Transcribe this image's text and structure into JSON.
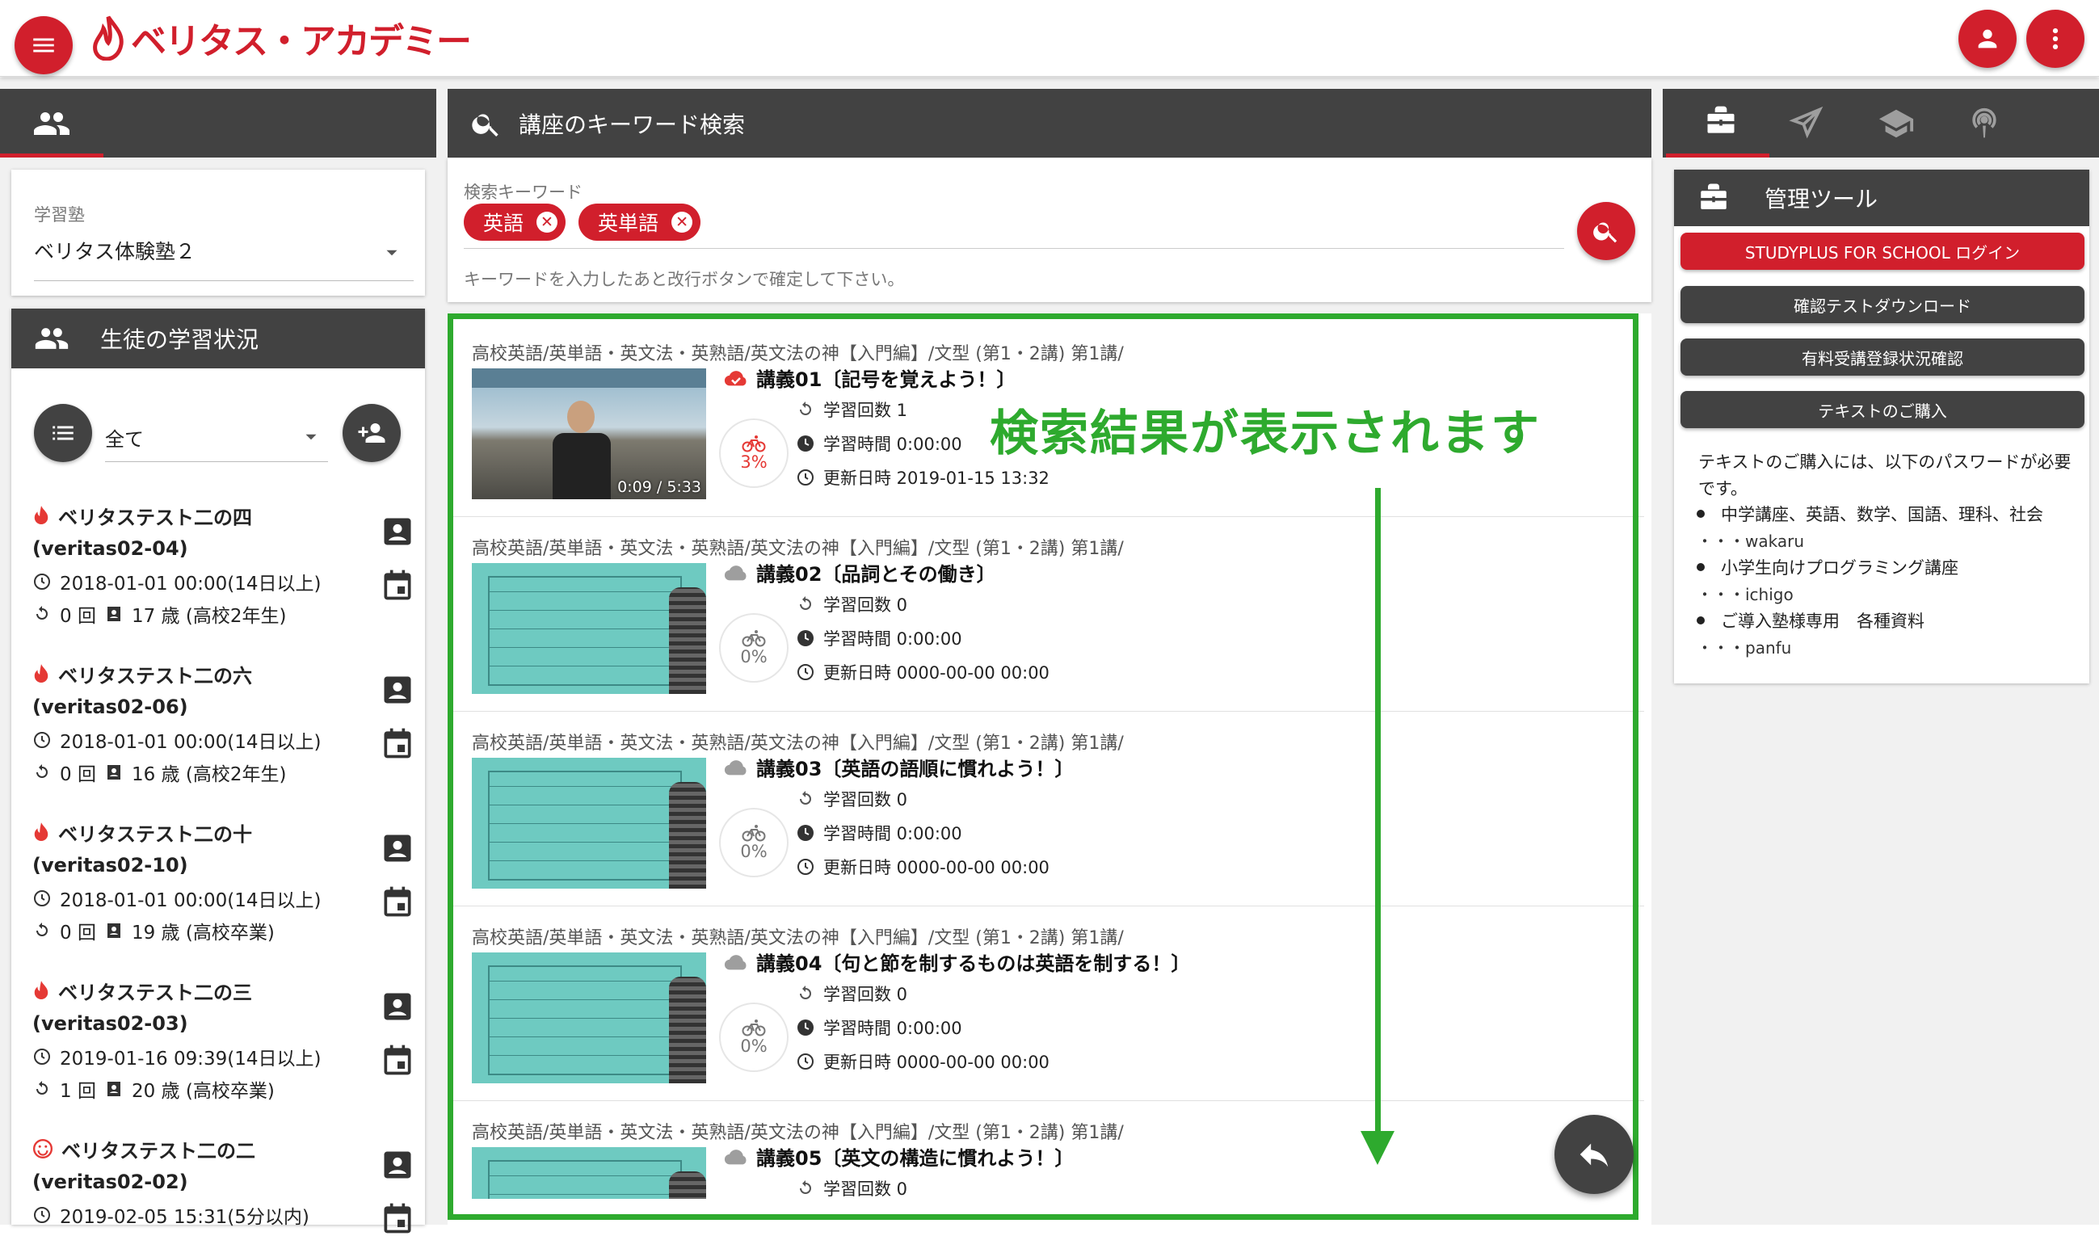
{
  "app": {
    "title": "ベリタス・アカデミー"
  },
  "left": {
    "school_label": "学習塾",
    "school_value": "ベリタス体験塾２",
    "status_title": "生徒の学習状況",
    "filter_value": "全て",
    "students": [
      {
        "name": "ベリタステスト二の四",
        "id": "(veritas02-04)",
        "date": "2018-01-01 00:00(14日以上)",
        "count": "0 回",
        "age": "17 歳 (高校2年生)",
        "status_icon": "fire-icon"
      },
      {
        "name": "ベリタステスト二の六",
        "id": "(veritas02-06)",
        "date": "2018-01-01 00:00(14日以上)",
        "count": "0 回",
        "age": "16 歳 (高校2年生)",
        "status_icon": "fire-icon"
      },
      {
        "name": "ベリタステスト二の十",
        "id": "(veritas02-10)",
        "date": "2018-01-01 00:00(14日以上)",
        "count": "0 回",
        "age": "19 歳 (高校卒業)",
        "status_icon": "fire-icon"
      },
      {
        "name": "ベリタステスト二の三",
        "id": "(veritas02-03)",
        "date": "2019-01-16 09:39(14日以上)",
        "count": "1 回",
        "age": "20 歳 (高校卒業)",
        "status_icon": "fire-icon"
      },
      {
        "name": "ベリタステスト二の二",
        "id": "(veritas02-02)",
        "date": "2019-02-05 15:31(5分以内)",
        "count": "",
        "age": "",
        "status_icon": "smile-icon"
      }
    ]
  },
  "search": {
    "header": "講座のキーワード検索",
    "label": "検索キーワード",
    "chips": [
      "英語",
      "英単語"
    ],
    "hint": "キーワードを入力したあと改行ボタンで確定して下さい。"
  },
  "annotation": {
    "text": "検索結果が表示されます",
    "color": "#2eaa2e"
  },
  "results": [
    {
      "path": "高校英語/英単語・英文法・英熟語/英文法の神【入門編】/文型 (第1・2講) 第1講/",
      "title": "講義01〔記号を覚えよう！〕",
      "count": "学習回数 1",
      "time": "学習時間 0:00:00",
      "updated": "更新日時 2019-01-15 13:32",
      "progress": "3%",
      "progress_value": 0.03,
      "video_time": "0:09 / 5:33",
      "cloud": "red"
    },
    {
      "path": "高校英語/英単語・英文法・英熟語/英文法の神【入門編】/文型 (第1・2講) 第1講/",
      "title": "講義02〔品詞とその働き〕",
      "count": "学習回数 0",
      "time": "学習時間 0:00:00",
      "updated": "更新日時 0000-00-00 00:00",
      "progress": "0%",
      "progress_value": 0,
      "video_time": "",
      "cloud": "grey"
    },
    {
      "path": "高校英語/英単語・英文法・英熟語/英文法の神【入門編】/文型 (第1・2講) 第1講/",
      "title": "講義03〔英語の語順に慣れよう！〕",
      "count": "学習回数 0",
      "time": "学習時間 0:00:00",
      "updated": "更新日時 0000-00-00 00:00",
      "progress": "0%",
      "progress_value": 0,
      "video_time": "",
      "cloud": "grey"
    },
    {
      "path": "高校英語/英単語・英文法・英熟語/英文法の神【入門編】/文型 (第1・2講) 第1講/",
      "title": "講義04〔句と節を制するものは英語を制する！〕",
      "count": "学習回数 0",
      "time": "学習時間 0:00:00",
      "updated": "更新日時 0000-00-00 00:00",
      "progress": "0%",
      "progress_value": 0,
      "video_time": "",
      "cloud": "grey"
    },
    {
      "path": "高校英語/英単語・英文法・英熟語/英文法の神【入門編】/文型 (第1・2講) 第1講/",
      "title": "講義05〔英文の構造に慣れよう！〕",
      "count": "学習回数 0",
      "time": "",
      "updated": "",
      "progress": "",
      "progress_value": 0,
      "video_time": "",
      "cloud": "grey"
    }
  ],
  "right": {
    "tools_title": "管理ツール",
    "buttons": [
      {
        "label": "STUDYPLUS FOR SCHOOL ログイン",
        "color": "#d11f2c"
      },
      {
        "label": "確認テストダウンロード",
        "color": "#424242"
      },
      {
        "label": "有料受講登録状況確認",
        "color": "#424242"
      },
      {
        "label": "テキストのご購入",
        "color": "#424242"
      }
    ],
    "info_intro": "テキストのご購入には、以下のパスワードが必要です。",
    "info_items": [
      {
        "title": "中学講座、英語、数学、国語、理科、社会",
        "password": "・・・wakaru"
      },
      {
        "title": "小学生向けプログラミング講座",
        "password": "・・・ichigo"
      },
      {
        "title": "ご導入塾様専用　各種資料",
        "password": "・・・panfu"
      }
    ]
  },
  "colors": {
    "brand": "#d11f2c",
    "dark": "#424242",
    "annotation": "#2eaa2e"
  }
}
